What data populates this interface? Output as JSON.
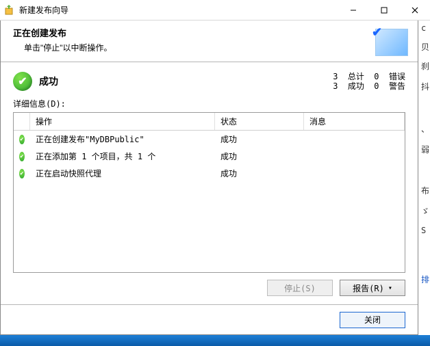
{
  "window": {
    "title": "新建发布向导"
  },
  "header": {
    "title": "正在创建发布",
    "subtitle": "单击\"停止\"以中断操作。"
  },
  "summary": {
    "status_label": "成功",
    "stats_line1": "3  总计  0  错误",
    "stats_line2": "3  成功  0  警告"
  },
  "detail_label": "详细信息(D):",
  "columns": {
    "operation": "操作",
    "status": "状态",
    "message": "消息"
  },
  "rows": [
    {
      "op": "正在创建发布\"MyDBPublic\"",
      "status": "成功",
      "msg": ""
    },
    {
      "op": "正在添加第 1 个项目，共 1 个",
      "status": "成功",
      "msg": ""
    },
    {
      "op": "正在启动快照代理",
      "status": "成功",
      "msg": ""
    }
  ],
  "buttons": {
    "stop": "停止(S)",
    "report": "报告(R)",
    "close": "关闭"
  }
}
